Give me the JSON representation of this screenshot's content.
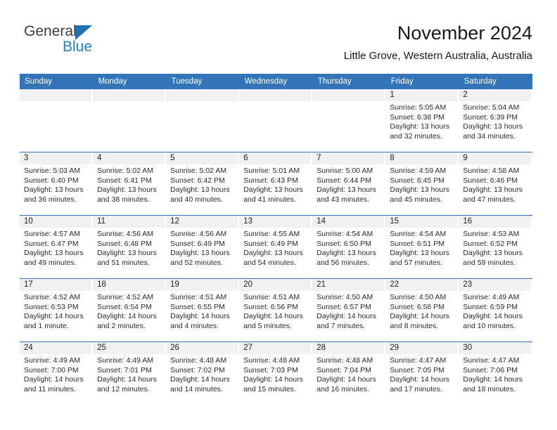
{
  "brand": {
    "name_part1": "General",
    "name_part2": "Blue",
    "triangle_color": "#1c71b8",
    "blue_color": "#2083c8"
  },
  "header": {
    "title": "November 2024",
    "subtitle": "Little Grove, Western Australia, Australia"
  },
  "theme": {
    "header_blue": "#3174b8",
    "daynum_strip_gray": "#f0f0f0",
    "text_color": "#222222"
  },
  "calendar": {
    "weekday_headers": [
      "Sunday",
      "Monday",
      "Tuesday",
      "Wednesday",
      "Thursday",
      "Friday",
      "Saturday"
    ],
    "weeks": [
      [
        {
          "day": "",
          "empty": true,
          "sunrise": "",
          "sunset": "",
          "daylight1": "",
          "daylight2": ""
        },
        {
          "day": "",
          "empty": true,
          "sunrise": "",
          "sunset": "",
          "daylight1": "",
          "daylight2": ""
        },
        {
          "day": "",
          "empty": true,
          "sunrise": "",
          "sunset": "",
          "daylight1": "",
          "daylight2": ""
        },
        {
          "day": "",
          "empty": true,
          "sunrise": "",
          "sunset": "",
          "daylight1": "",
          "daylight2": ""
        },
        {
          "day": "",
          "empty": true,
          "sunrise": "",
          "sunset": "",
          "daylight1": "",
          "daylight2": ""
        },
        {
          "day": "1",
          "sunrise": "Sunrise: 5:05 AM",
          "sunset": "Sunset: 6:38 PM",
          "daylight1": "Daylight: 13 hours",
          "daylight2": "and 32 minutes."
        },
        {
          "day": "2",
          "sunrise": "Sunrise: 5:04 AM",
          "sunset": "Sunset: 6:39 PM",
          "daylight1": "Daylight: 13 hours",
          "daylight2": "and 34 minutes."
        }
      ],
      [
        {
          "day": "3",
          "sunrise": "Sunrise: 5:03 AM",
          "sunset": "Sunset: 6:40 PM",
          "daylight1": "Daylight: 13 hours",
          "daylight2": "and 36 minutes."
        },
        {
          "day": "4",
          "sunrise": "Sunrise: 5:02 AM",
          "sunset": "Sunset: 6:41 PM",
          "daylight1": "Daylight: 13 hours",
          "daylight2": "and 38 minutes."
        },
        {
          "day": "5",
          "sunrise": "Sunrise: 5:02 AM",
          "sunset": "Sunset: 6:42 PM",
          "daylight1": "Daylight: 13 hours",
          "daylight2": "and 40 minutes."
        },
        {
          "day": "6",
          "sunrise": "Sunrise: 5:01 AM",
          "sunset": "Sunset: 6:43 PM",
          "daylight1": "Daylight: 13 hours",
          "daylight2": "and 41 minutes."
        },
        {
          "day": "7",
          "sunrise": "Sunrise: 5:00 AM",
          "sunset": "Sunset: 6:44 PM",
          "daylight1": "Daylight: 13 hours",
          "daylight2": "and 43 minutes."
        },
        {
          "day": "8",
          "sunrise": "Sunrise: 4:59 AM",
          "sunset": "Sunset: 6:45 PM",
          "daylight1": "Daylight: 13 hours",
          "daylight2": "and 45 minutes."
        },
        {
          "day": "9",
          "sunrise": "Sunrise: 4:58 AM",
          "sunset": "Sunset: 6:46 PM",
          "daylight1": "Daylight: 13 hours",
          "daylight2": "and 47 minutes."
        }
      ],
      [
        {
          "day": "10",
          "sunrise": "Sunrise: 4:57 AM",
          "sunset": "Sunset: 6:47 PM",
          "daylight1": "Daylight: 13 hours",
          "daylight2": "and 49 minutes."
        },
        {
          "day": "11",
          "sunrise": "Sunrise: 4:56 AM",
          "sunset": "Sunset: 6:48 PM",
          "daylight1": "Daylight: 13 hours",
          "daylight2": "and 51 minutes."
        },
        {
          "day": "12",
          "sunrise": "Sunrise: 4:56 AM",
          "sunset": "Sunset: 6:49 PM",
          "daylight1": "Daylight: 13 hours",
          "daylight2": "and 52 minutes."
        },
        {
          "day": "13",
          "sunrise": "Sunrise: 4:55 AM",
          "sunset": "Sunset: 6:49 PM",
          "daylight1": "Daylight: 13 hours",
          "daylight2": "and 54 minutes."
        },
        {
          "day": "14",
          "sunrise": "Sunrise: 4:54 AM",
          "sunset": "Sunset: 6:50 PM",
          "daylight1": "Daylight: 13 hours",
          "daylight2": "and 56 minutes."
        },
        {
          "day": "15",
          "sunrise": "Sunrise: 4:54 AM",
          "sunset": "Sunset: 6:51 PM",
          "daylight1": "Daylight: 13 hours",
          "daylight2": "and 57 minutes."
        },
        {
          "day": "16",
          "sunrise": "Sunrise: 4:53 AM",
          "sunset": "Sunset: 6:52 PM",
          "daylight1": "Daylight: 13 hours",
          "daylight2": "and 59 minutes."
        }
      ],
      [
        {
          "day": "17",
          "sunrise": "Sunrise: 4:52 AM",
          "sunset": "Sunset: 6:53 PM",
          "daylight1": "Daylight: 14 hours",
          "daylight2": "and 1 minute."
        },
        {
          "day": "18",
          "sunrise": "Sunrise: 4:52 AM",
          "sunset": "Sunset: 6:54 PM",
          "daylight1": "Daylight: 14 hours",
          "daylight2": "and 2 minutes."
        },
        {
          "day": "19",
          "sunrise": "Sunrise: 4:51 AM",
          "sunset": "Sunset: 6:55 PM",
          "daylight1": "Daylight: 14 hours",
          "daylight2": "and 4 minutes."
        },
        {
          "day": "20",
          "sunrise": "Sunrise: 4:51 AM",
          "sunset": "Sunset: 6:56 PM",
          "daylight1": "Daylight: 14 hours",
          "daylight2": "and 5 minutes."
        },
        {
          "day": "21",
          "sunrise": "Sunrise: 4:50 AM",
          "sunset": "Sunset: 6:57 PM",
          "daylight1": "Daylight: 14 hours",
          "daylight2": "and 7 minutes."
        },
        {
          "day": "22",
          "sunrise": "Sunrise: 4:50 AM",
          "sunset": "Sunset: 6:58 PM",
          "daylight1": "Daylight: 14 hours",
          "daylight2": "and 8 minutes."
        },
        {
          "day": "23",
          "sunrise": "Sunrise: 4:49 AM",
          "sunset": "Sunset: 6:59 PM",
          "daylight1": "Daylight: 14 hours",
          "daylight2": "and 10 minutes."
        }
      ],
      [
        {
          "day": "24",
          "sunrise": "Sunrise: 4:49 AM",
          "sunset": "Sunset: 7:00 PM",
          "daylight1": "Daylight: 14 hours",
          "daylight2": "and 11 minutes."
        },
        {
          "day": "25",
          "sunrise": "Sunrise: 4:49 AM",
          "sunset": "Sunset: 7:01 PM",
          "daylight1": "Daylight: 14 hours",
          "daylight2": "and 12 minutes."
        },
        {
          "day": "26",
          "sunrise": "Sunrise: 4:48 AM",
          "sunset": "Sunset: 7:02 PM",
          "daylight1": "Daylight: 14 hours",
          "daylight2": "and 14 minutes."
        },
        {
          "day": "27",
          "sunrise": "Sunrise: 4:48 AM",
          "sunset": "Sunset: 7:03 PM",
          "daylight1": "Daylight: 14 hours",
          "daylight2": "and 15 minutes."
        },
        {
          "day": "28",
          "sunrise": "Sunrise: 4:48 AM",
          "sunset": "Sunset: 7:04 PM",
          "daylight1": "Daylight: 14 hours",
          "daylight2": "and 16 minutes."
        },
        {
          "day": "29",
          "sunrise": "Sunrise: 4:47 AM",
          "sunset": "Sunset: 7:05 PM",
          "daylight1": "Daylight: 14 hours",
          "daylight2": "and 17 minutes."
        },
        {
          "day": "30",
          "sunrise": "Sunrise: 4:47 AM",
          "sunset": "Sunset: 7:06 PM",
          "daylight1": "Daylight: 14 hours",
          "daylight2": "and 18 minutes."
        }
      ]
    ]
  }
}
